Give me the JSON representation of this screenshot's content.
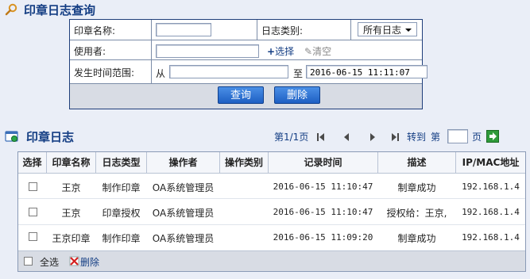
{
  "query_panel": {
    "title": "印章日志查询",
    "seal_name_label": "印章名称:",
    "seal_name_value": "",
    "log_type_label": "日志类别:",
    "log_type_selected": "所有日志",
    "user_label": "使用者:",
    "user_value": "",
    "select_link": "选择",
    "clear_link": "清空",
    "time_range_label": "发生时间范围:",
    "from_label": "从",
    "from_value": "",
    "to_label": "至",
    "to_value": "2016-06-15 11:11:07",
    "query_button": "查询",
    "delete_button": "删除"
  },
  "log_panel": {
    "title": "印章日志",
    "page_info": "第1/1页",
    "goto_label": "转到",
    "page_prefix": "第",
    "page_input": "",
    "page_suffix": "页",
    "columns": [
      "选择",
      "印章名称",
      "日志类型",
      "操作者",
      "操作类别",
      "记录时间",
      "描述",
      "IP/MAC地址"
    ],
    "rows": [
      {
        "seal": "王京",
        "type": "制作印章",
        "operator": "OA系统管理员",
        "op_category": "",
        "time": "2016-06-15 11:10:47",
        "desc": "制章成功",
        "ip": "192.168.1.4"
      },
      {
        "seal": "王京",
        "type": "印章授权",
        "operator": "OA系统管理员",
        "op_category": "",
        "time": "2016-06-15 11:10:47",
        "desc": "授权给：王京,",
        "ip": "192.168.1.4"
      },
      {
        "seal": "王京印章",
        "type": "制作印章",
        "operator": "OA系统管理员",
        "op_category": "",
        "time": "2016-06-15 11:09:20",
        "desc": "制章成功",
        "ip": "192.168.1.4"
      }
    ],
    "select_all_label": "全选",
    "delete_label": "删除"
  },
  "colors": {
    "accent": "#133d83",
    "button": "#2a6fd3"
  }
}
